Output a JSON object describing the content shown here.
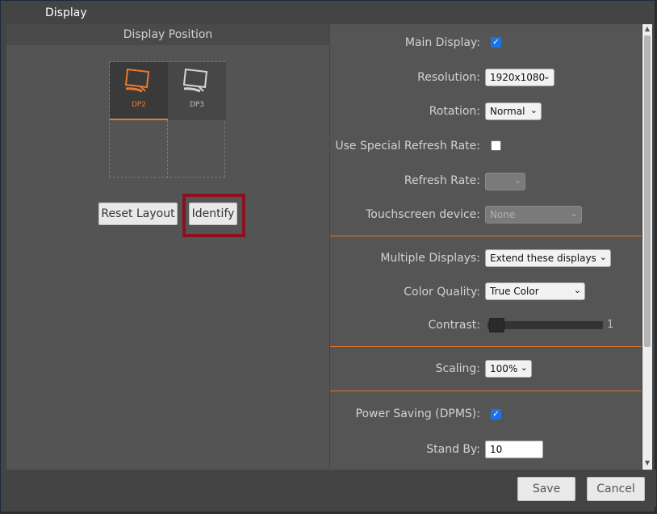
{
  "window": {
    "title": "Display"
  },
  "left": {
    "header": "Display Position",
    "monitors": [
      {
        "label": "DP2",
        "color": "#e87a2f",
        "selected": true
      },
      {
        "label": "DP3",
        "color": "#bdbdbd",
        "selected": false
      }
    ],
    "reset_label": "Reset Layout",
    "identify_label": "Identify"
  },
  "settings": {
    "main_display": {
      "label": "Main Display:",
      "checked": true
    },
    "resolution": {
      "label": "Resolution:",
      "value": "1920x1080"
    },
    "rotation": {
      "label": "Rotation:",
      "value": "Normal"
    },
    "special_refresh": {
      "label": "Use Special Refresh Rate:",
      "checked": false
    },
    "refresh_rate": {
      "label": "Refresh Rate:",
      "value": ""
    },
    "touchscreen": {
      "label": "Touchscreen device:",
      "value": "None"
    },
    "multiple_displays": {
      "label": "Multiple Displays:",
      "value": "Extend these displays"
    },
    "color_quality": {
      "label": "Color Quality:",
      "value": "True Color"
    },
    "contrast": {
      "label": "Contrast:",
      "value": "1"
    },
    "scaling": {
      "label": "Scaling:",
      "value": "100%"
    },
    "power_saving": {
      "label": "Power Saving (DPMS):",
      "checked": true
    },
    "stand_by": {
      "label": "Stand By:",
      "value": "10"
    }
  },
  "footer": {
    "save_label": "Save",
    "cancel_label": "Cancel"
  },
  "colors": {
    "accent": "#e87a2f",
    "highlight": "#8b1020",
    "check": "#1a73e8"
  }
}
